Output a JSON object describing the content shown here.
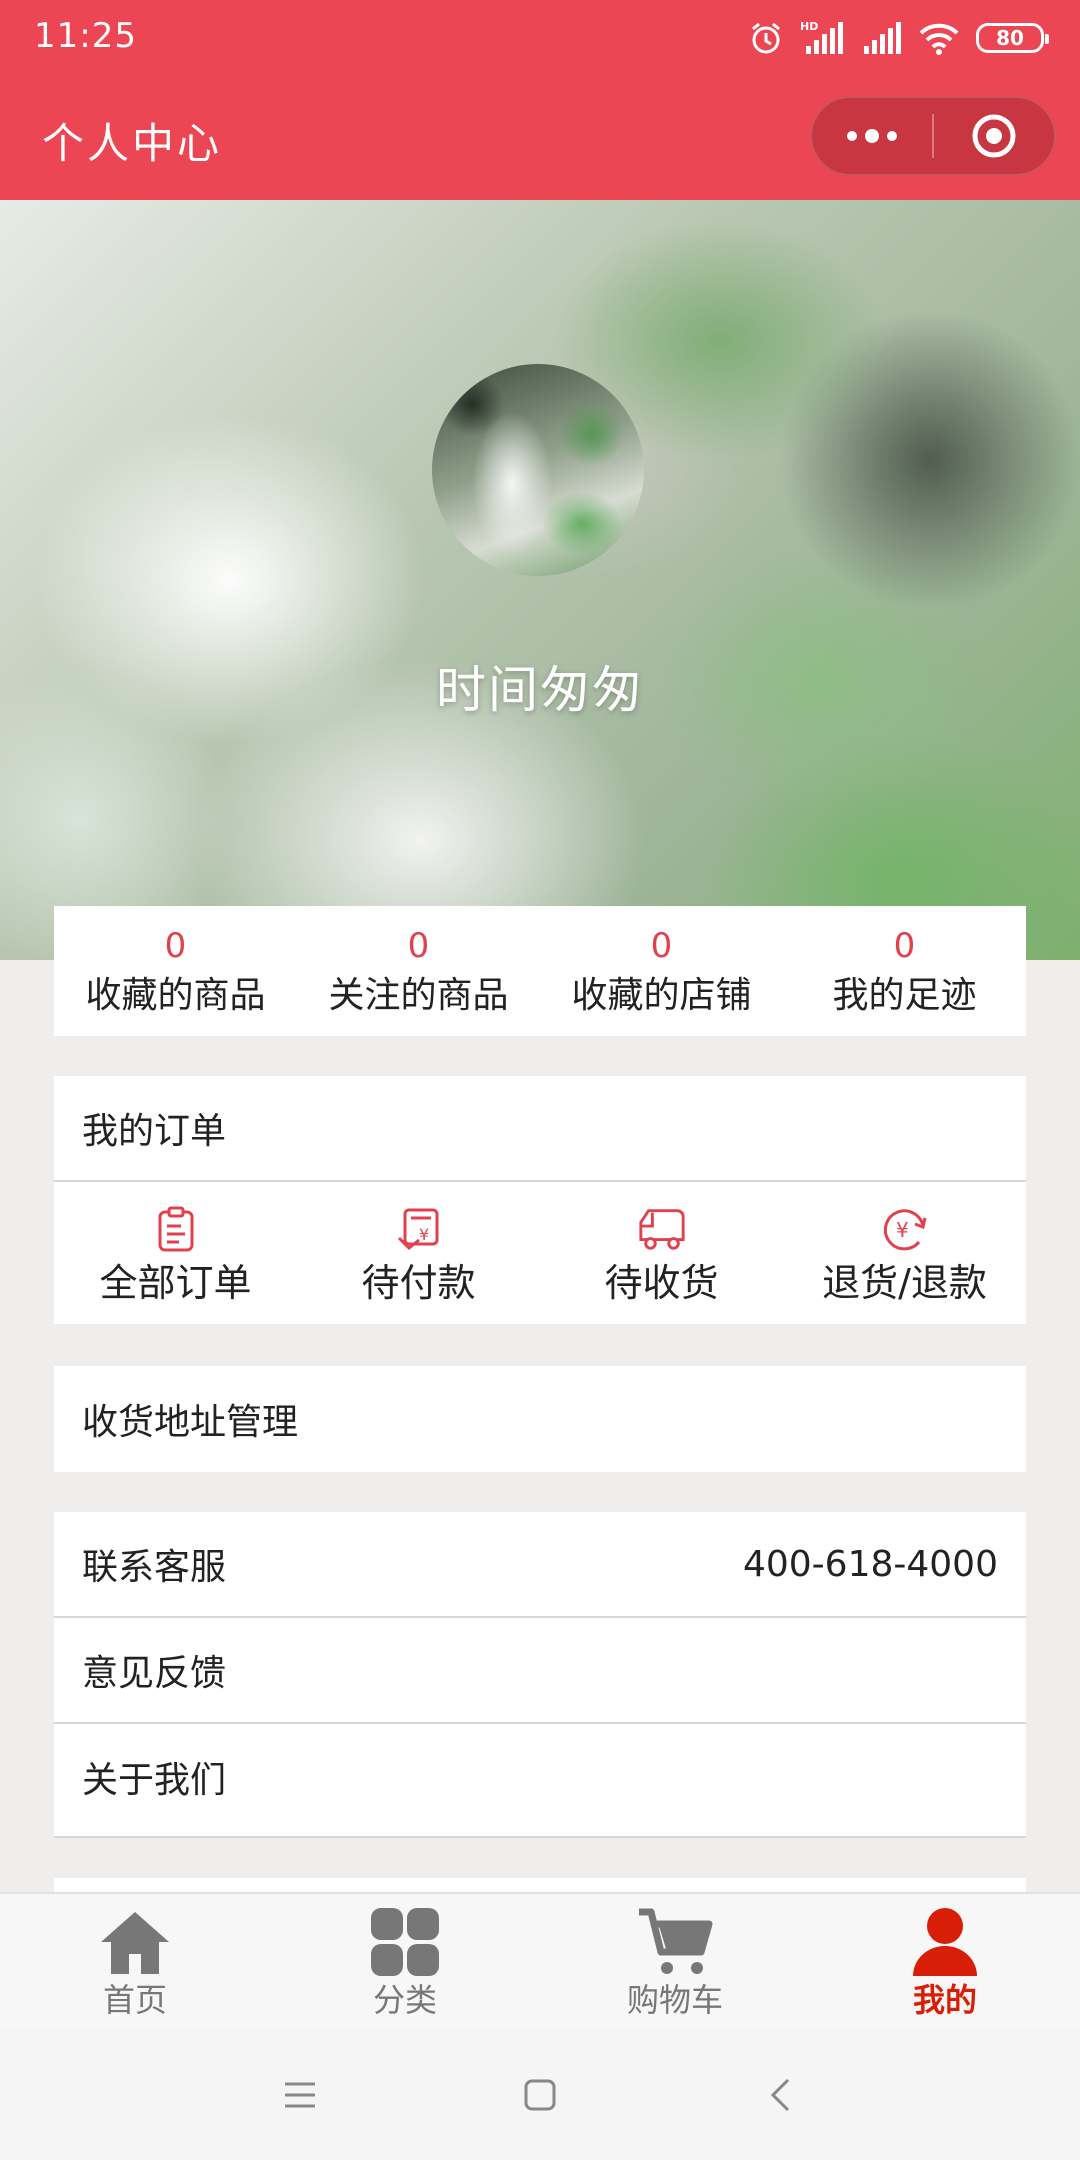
{
  "status_bar": {
    "time": "11:25",
    "network_label": "HD",
    "battery": "80"
  },
  "header": {
    "title": "个人中心"
  },
  "profile": {
    "nickname": "时间匆匆"
  },
  "stats": [
    {
      "value": "0",
      "label": "收藏的商品"
    },
    {
      "value": "0",
      "label": "关注的商品"
    },
    {
      "value": "0",
      "label": "收藏的店铺"
    },
    {
      "value": "0",
      "label": "我的足迹"
    }
  ],
  "orders": {
    "title": "我的订单",
    "items": [
      {
        "label": "全部订单",
        "icon": "clipboard-icon"
      },
      {
        "label": "待付款",
        "icon": "payment-icon"
      },
      {
        "label": "待收货",
        "icon": "delivery-truck-icon"
      },
      {
        "label": "退货/退款",
        "icon": "refund-icon"
      }
    ]
  },
  "address": {
    "label": "收货地址管理"
  },
  "service": {
    "contact_label": "联系客服",
    "contact_phone": "400-618-4000",
    "feedback_label": "意见反馈",
    "about_label": "关于我们"
  },
  "tabs": [
    {
      "label": "首页",
      "icon": "home-icon"
    },
    {
      "label": "分类",
      "icon": "category-grid-icon"
    },
    {
      "label": "购物车",
      "icon": "cart-icon"
    },
    {
      "label": "我的",
      "icon": "user-icon",
      "active": true
    }
  ],
  "colors": {
    "brand": "#ec4553",
    "accent_text": "#e0414c",
    "tab_active": "#d81e06",
    "tab_inactive": "#777777",
    "page_bg": "#efeeec"
  }
}
